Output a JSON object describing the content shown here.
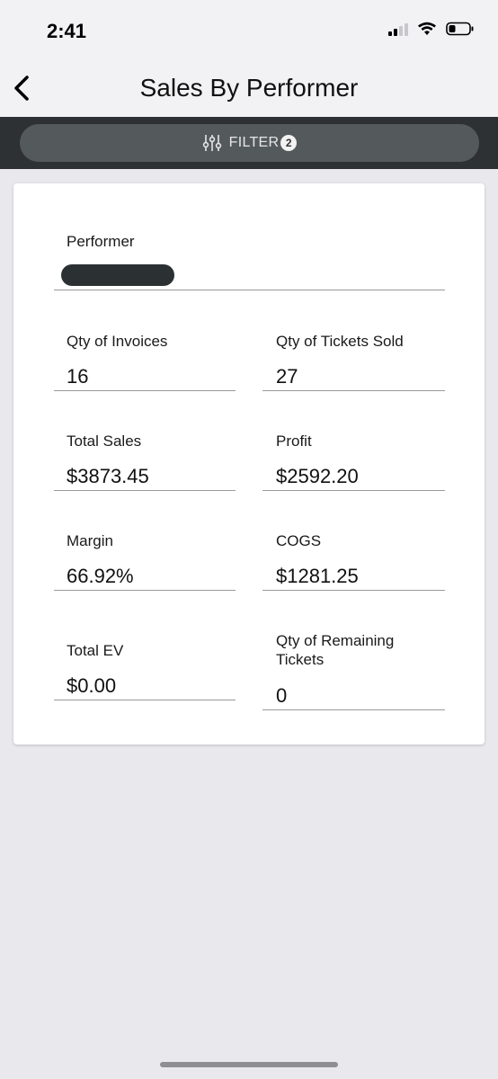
{
  "status_bar": {
    "time": "2:41"
  },
  "nav": {
    "title": "Sales By Performer",
    "back_icon": "chevron-left-icon"
  },
  "filter": {
    "label": "FILTER",
    "count": "2",
    "icon": "sliders-icon"
  },
  "card": {
    "performer_label": "Performer",
    "fields": {
      "qty_invoices": {
        "label": "Qty of Invoices",
        "value": "16"
      },
      "qty_tickets_sold": {
        "label": "Qty of Tickets Sold",
        "value": "27"
      },
      "total_sales": {
        "label": "Total Sales",
        "value": "$3873.45"
      },
      "profit": {
        "label": "Profit",
        "value": "$2592.20"
      },
      "margin": {
        "label": "Margin",
        "value": "66.92%"
      },
      "cogs": {
        "label": "COGS",
        "value": "$1281.25"
      },
      "total_ev": {
        "label": "Total EV",
        "value": "$0.00"
      },
      "qty_remaining": {
        "label": "Qty of Remaining Tickets",
        "value": "0"
      }
    }
  }
}
